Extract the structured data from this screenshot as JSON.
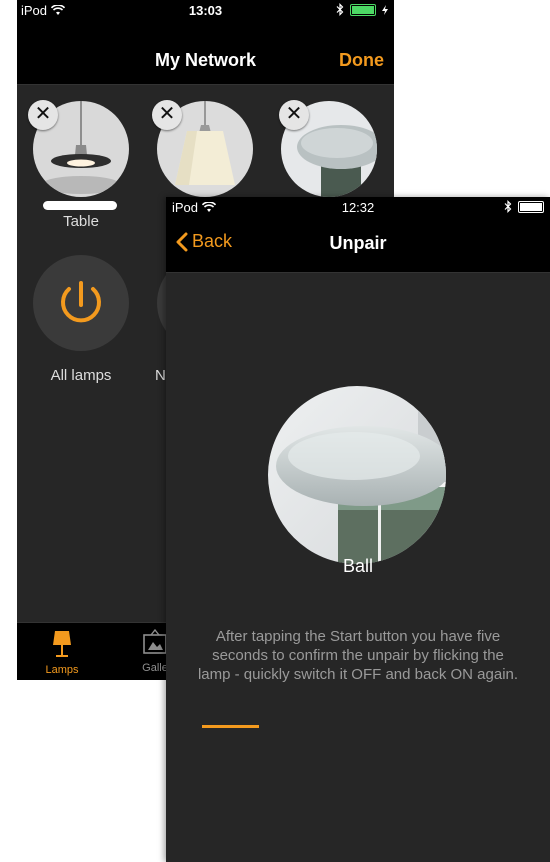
{
  "back_screen": {
    "status": {
      "carrier": "iPod",
      "time": "13:03"
    },
    "nav": {
      "title": "My Network",
      "done_label": "Done"
    },
    "lamps": [
      {
        "label": "Table"
      }
    ],
    "groups": [
      {
        "label": "All lamps"
      },
      {
        "label": "N"
      }
    ],
    "tabs": [
      {
        "label": "Lamps"
      },
      {
        "label": "Galle"
      }
    ]
  },
  "front_screen": {
    "status": {
      "carrier": "iPod",
      "time": "12:32"
    },
    "nav": {
      "back_label": "Back",
      "title": "Unpair"
    },
    "lamp_name": "Ball",
    "instructions": "After tapping the Start button you have five seconds to confirm the unpair by flicking the lamp - quickly switch it OFF and back ON again.",
    "progress": 0.15
  },
  "colors": {
    "accent": "#f39a1e",
    "background": "#262626",
    "bar": "#000000"
  }
}
